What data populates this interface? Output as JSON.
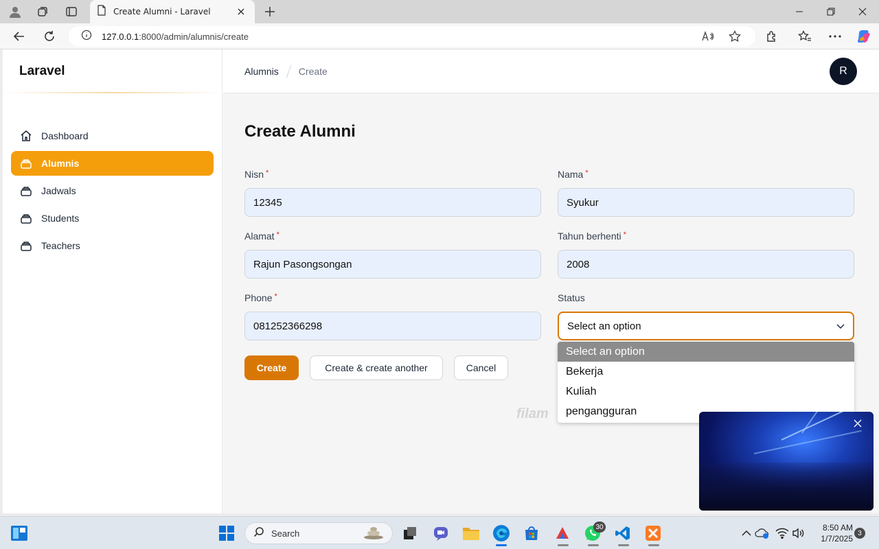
{
  "browser": {
    "tab_title": "Create Alumni - Laravel",
    "url_host": "127.0.0.1",
    "url_rest": ":8000/admin/alumnis/create"
  },
  "sidebar": {
    "brand": "Laravel",
    "items": [
      {
        "label": "Dashboard",
        "icon": "home-icon",
        "active": false
      },
      {
        "label": "Alumnis",
        "icon": "collection-icon",
        "active": true
      },
      {
        "label": "Jadwals",
        "icon": "collection-icon",
        "active": false
      },
      {
        "label": "Students",
        "icon": "collection-icon",
        "active": false
      },
      {
        "label": "Teachers",
        "icon": "collection-icon",
        "active": false
      }
    ]
  },
  "topbar": {
    "breadcrumb": [
      "Alumnis",
      "Create"
    ],
    "avatar_initial": "R"
  },
  "page": {
    "title": "Create Alumni"
  },
  "form": {
    "nisn": {
      "label": "Nisn",
      "value": "12345",
      "required": true
    },
    "nama": {
      "label": "Nama",
      "value": "Syukur",
      "required": true
    },
    "alamat": {
      "label": "Alamat",
      "value": "Rajun Pasongsongan",
      "required": true
    },
    "tahun_berhenti": {
      "label": "Tahun berhenti",
      "value": "2008",
      "required": true
    },
    "phone": {
      "label": "Phone",
      "value": "081252366298",
      "required": true
    },
    "status": {
      "label": "Status",
      "value": "Select an option",
      "required": false
    }
  },
  "buttons": {
    "create": "Create",
    "create_another": "Create & create another",
    "cancel": "Cancel"
  },
  "dropdown": {
    "options": [
      "Select an option",
      "Bekerja",
      "Kuliah",
      "pengangguran"
    ],
    "selected_index": 0
  },
  "watermark": "filam",
  "taskbar": {
    "search_label": "Search",
    "whatsapp_badge": "30",
    "time": "8:50 AM",
    "date": "1/7/2025",
    "notifications": "3"
  },
  "colors": {
    "accent": "#f59e0b",
    "primary_button": "#d97706",
    "required_mark": "#dc2626",
    "avatar_bg": "#0b1526"
  }
}
